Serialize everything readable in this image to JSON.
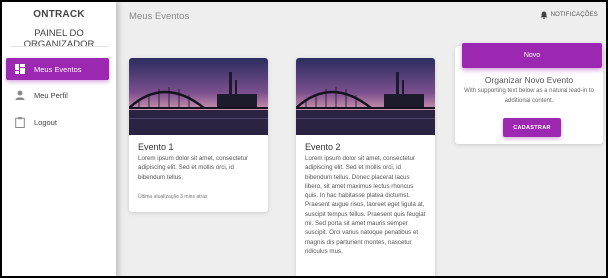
{
  "sidebar": {
    "brand": "ONTRACK",
    "subtitle": "PAINEL DO ORGANIZADOR",
    "items": [
      {
        "label": "Meus Eventos",
        "icon": "dashboard-icon",
        "active": true
      },
      {
        "label": "Meu Perfil",
        "icon": "person-icon",
        "active": false
      },
      {
        "label": "Logout",
        "icon": "clipboard-icon",
        "active": false
      }
    ]
  },
  "header": {
    "title": "Meus Eventos",
    "notifications_label": "NOTIFICAÇÕES",
    "notifications_icon": "bell-icon"
  },
  "events": [
    {
      "title": "Evento 1",
      "text": "Lorem ipsum dolor sit amet, consectetur adipiscing elit. Sed et mollis orci, id bibendum tellus.",
      "footer": "Última atualização 3 mins atrás"
    },
    {
      "title": "Evento 2",
      "text": "Lorem ipsum dolor sit amet, consectetur adipiscing elit. Sed et mollis orci, id bibendum tellus. Donec placerat lacus libero, sit amet maximus lectus rhoncus quis. In hac habitasse platea dictumst. Praesent augue risus, laoreet eget ligula at, suscipit tempus tellus. Praesent quis feugiat mi. Sed porta sit amet mauris semper suscipit. Orci varius natoque penatibus et magnis dis parturient montes, nascetur ridiculus mus."
    }
  ],
  "new_event": {
    "header_label": "Novo",
    "title": "Organizar Novo Evento",
    "text": "With supporting text below as a natural lead-in to additional content.",
    "button_label": "CADASTRAR"
  },
  "colors": {
    "accent": "#9c27b0",
    "background": "#eeeeee"
  }
}
